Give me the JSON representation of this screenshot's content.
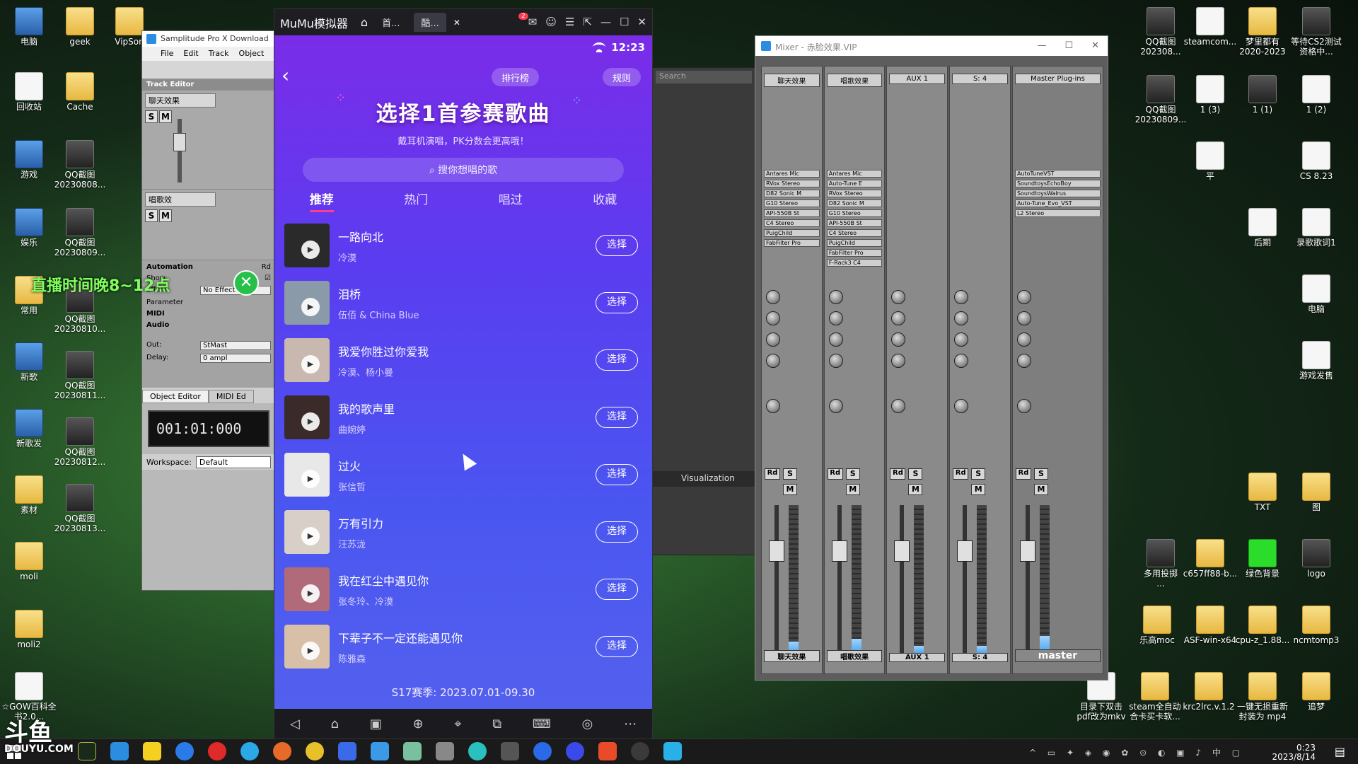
{
  "desktop": {
    "icons_left": [
      {
        "label": "电脑"
      },
      {
        "label": "geek"
      },
      {
        "label": "VipSon"
      },
      {
        "label": "回收站"
      },
      {
        "label": "Cache"
      },
      {
        "label": "游戏"
      },
      {
        "label": "QQ截图\n20230808..."
      },
      {
        "label": "娱乐"
      },
      {
        "label": "QQ截图\n20230809..."
      },
      {
        "label": "常用"
      },
      {
        "label": "QQ截图\n20230810..."
      },
      {
        "label": "新歌"
      },
      {
        "label": "QQ截图\n20230811..."
      },
      {
        "label": "新歌发"
      },
      {
        "label": "QQ截图\n20230812..."
      },
      {
        "label": "素材"
      },
      {
        "label": "QQ截图\n20230813..."
      },
      {
        "label": "moli"
      },
      {
        "label": "moli2"
      },
      {
        "label": "☆GOW百科全书2.0..."
      }
    ],
    "icons_right": [
      {
        "label": "QQ截图\n202308..."
      },
      {
        "label": "steamcom..."
      },
      {
        "label": "梦里都有\n2020-2023"
      },
      {
        "label": "等待CS2测试\n资格中..."
      },
      {
        "label": "QQ截图\n20230809..."
      },
      {
        "label": "1 (3)"
      },
      {
        "label": "1 (1)"
      },
      {
        "label": "1 (2)"
      },
      {
        "label": "平"
      },
      {
        "label": "CS 8.23"
      },
      {
        "label": "后期"
      },
      {
        "label": "录歌歌词1"
      },
      {
        "label": "电脑"
      },
      {
        "label": "游戏发售"
      },
      {
        "label": "TXT"
      },
      {
        "label": "图"
      },
      {
        "label": "多用投掷\n..."
      },
      {
        "label": "c657ff88-b..."
      },
      {
        "label": "绿色背景"
      },
      {
        "label": "logo"
      },
      {
        "label": "乐高moc"
      },
      {
        "label": "ASF-win-x64"
      },
      {
        "label": "cpu-z_1.88..."
      },
      {
        "label": "ncmtomp3"
      },
      {
        "label": "目录下双击\npdf改为mkv"
      },
      {
        "label": "steam全自动\n合卡买卡软..."
      },
      {
        "label": "krc2lrc.v.1.2"
      },
      {
        "label": "一键无损重新\n封装为 mp4"
      },
      {
        "label": "追梦"
      }
    ],
    "overlay_text": "直播时间晚8~12点"
  },
  "samplitude": {
    "title": "Samplitude Pro X Download",
    "menu": [
      "File",
      "Edit",
      "Track",
      "Object"
    ],
    "track_editor_label": "Track Editor",
    "track1_name": "聊天效果",
    "track2_name": "唱歌效",
    "automation_label": "Automation",
    "show_label": "Show",
    "effect_label": "Effect:",
    "effect_value": "No Effect",
    "parameter_label": "Parameter",
    "midi_label": "MIDI",
    "audio_label": "Audio",
    "out_label": "Out:",
    "out_value": "StMast",
    "delay_label": "Delay:",
    "delay_value": "0 ampl",
    "object_editor_tab": "Object Editor",
    "midi_editor_tab": "MIDI Ed",
    "timecode": "001:01:000",
    "workspace_label": "Workspace:",
    "workspace_value": "Default"
  },
  "mumu": {
    "app_name": "MuMu模拟器",
    "tabs": [
      "首...",
      "酷..."
    ],
    "notify_count": "2",
    "time": "12:23",
    "top_buttons": {
      "rank": "排行榜",
      "rules": "规则"
    },
    "hero_title": "选择1首参赛歌曲",
    "hero_sub": "戴耳机演唱，PK分数会更高哦！",
    "search_placeholder": "搜你想唱的歌",
    "tabs_inner": [
      "推荐",
      "热门",
      "唱过",
      "收藏"
    ],
    "choose_label": "选择",
    "songs": [
      {
        "title": "一路向北",
        "artist": "冷漠",
        "cover": "#2a2a2a"
      },
      {
        "title": "泪桥",
        "artist": "伍佰 & China Blue",
        "cover": "#8a9aa8"
      },
      {
        "title": "我爱你胜过你爱我",
        "artist": "冷漠、杨小曼",
        "cover": "#c8b8b0"
      },
      {
        "title": "我的歌声里",
        "artist": "曲婉婷",
        "cover": "#3a2a2a"
      },
      {
        "title": "过火",
        "artist": "张信哲",
        "cover": "#e8e8e8"
      },
      {
        "title": "万有引力",
        "artist": "汪苏泷",
        "cover": "#d8d0c8"
      },
      {
        "title": "我在红尘中遇见你",
        "artist": "张冬玲、冷漠",
        "cover": "#b06a7a"
      },
      {
        "title": "下辈子不一定还能遇见你",
        "artist": "陈雅森",
        "cover": "#d8c0a8"
      }
    ],
    "season": "S17赛季: 2023.07.01-09.30"
  },
  "daw": {
    "search_placeholder": "Search",
    "visualization_tab": "Visualization"
  },
  "mixer": {
    "title": "Mixer - 赤脸效果.VIP",
    "strips": [
      {
        "top_name": "聊天效果",
        "bottom_name": "聊天效果",
        "plugins": [
          "Antares Mic",
          "RVox Stereo",
          "D82 Sonic M",
          "G10 Stereo",
          "API-550B St",
          "C4 Stereo",
          "PuigChild",
          "FabFilter Pro"
        ],
        "level": 0.08
      },
      {
        "top_name": "唱歌效果",
        "bottom_name": "唱歌效果",
        "plugins": [
          "Antares Mic",
          "Auto-Tune E",
          "RVox Stereo",
          "D82 Sonic M",
          "G10 Stereo",
          "API-550B St",
          "C4 Stereo",
          "PuigChild",
          "FabFilter Pro",
          "F-Rack3 C4"
        ],
        "level": 0.1
      },
      {
        "top_name": "AUX 1",
        "bottom_name": "AUX 1",
        "plugins": [],
        "level": 0.05
      },
      {
        "top_name": "S: 4",
        "bottom_name": "S: 4",
        "plugins": [],
        "level": 0.05
      },
      {
        "top_name": "Master Plug-ins",
        "bottom_name": "master",
        "plugins": [
          "AutoTuneVST",
          "SoundtoysEchoBoy",
          "SoundtoysWalrus",
          "Auto-Tune_Evo_VST",
          "L2 Stereo"
        ],
        "level": 0.12
      }
    ],
    "button_rd": "Rd",
    "button_s": "S",
    "button_m": "M"
  },
  "taskbar": {
    "time": "0:23",
    "date": "2023/8/14",
    "lang": "中"
  },
  "watermark": {
    "logo": "斗鱼",
    "site": "DOUYU.COM"
  }
}
